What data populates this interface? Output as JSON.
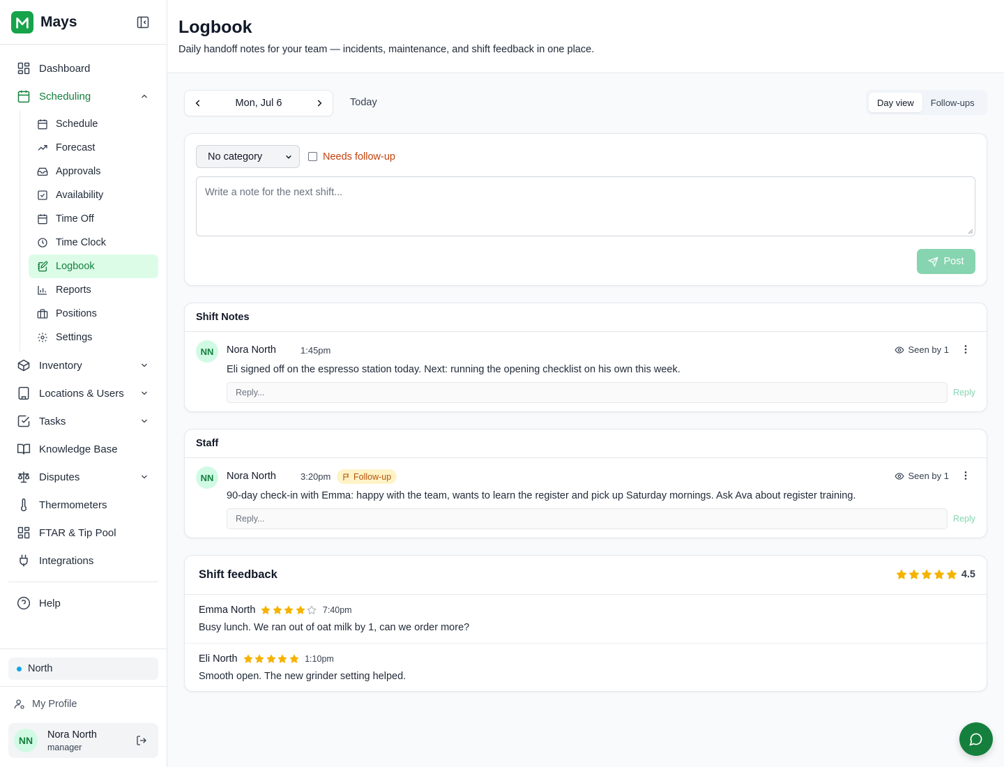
{
  "app": {
    "name": "Mays"
  },
  "colors": {
    "accent": "#15803d",
    "accent_light": "#dcfce7",
    "followup": "#c2410c",
    "star": "#f5b301",
    "location_dot": "#0ea5e9"
  },
  "sidebar": {
    "items": [
      {
        "label": "Dashboard",
        "icon": "dashboard-icon"
      },
      {
        "label": "Scheduling",
        "icon": "calendar-icon",
        "expanded": true
      },
      {
        "label": "Inventory",
        "icon": "box-icon",
        "expandable": true
      },
      {
        "label": "Locations & Users",
        "icon": "building-icon",
        "expandable": true
      },
      {
        "label": "Tasks",
        "icon": "checkbox-icon",
        "expandable": true
      },
      {
        "label": "Knowledge Base",
        "icon": "book-icon"
      },
      {
        "label": "Disputes",
        "icon": "scale-icon",
        "expandable": true
      },
      {
        "label": "Thermometers",
        "icon": "thermometer-icon"
      },
      {
        "label": "FTAR & Tip Pool",
        "icon": "grid-icon"
      },
      {
        "label": "Integrations",
        "icon": "plug-icon"
      },
      {
        "label": "Help",
        "icon": "help-icon"
      }
    ],
    "scheduling_sub": [
      {
        "label": "Schedule",
        "icon": "calendar-icon"
      },
      {
        "label": "Forecast",
        "icon": "trending-up-icon"
      },
      {
        "label": "Approvals",
        "icon": "inbox-icon"
      },
      {
        "label": "Availability",
        "icon": "calendar-check-icon"
      },
      {
        "label": "Time Off",
        "icon": "calendar-icon"
      },
      {
        "label": "Time Clock",
        "icon": "clock-icon"
      },
      {
        "label": "Logbook",
        "icon": "notebook-pen-icon",
        "active": true
      },
      {
        "label": "Reports",
        "icon": "bar-chart-icon"
      },
      {
        "label": "Positions",
        "icon": "briefcase-icon"
      },
      {
        "label": "Settings",
        "icon": "gear-icon"
      }
    ],
    "location": "North",
    "my_profile": "My Profile",
    "user": {
      "initials": "NN",
      "name": "Nora North",
      "role": "manager"
    }
  },
  "header": {
    "title": "Logbook",
    "subtitle": "Daily handoff notes for your team — incidents, maintenance, and shift feedback in one place."
  },
  "toolbar": {
    "date": "Mon, Jul 6",
    "today": "Today",
    "views": [
      "Day view",
      "Follow-ups"
    ],
    "active_view": "Day view"
  },
  "composer": {
    "category": "No category",
    "followup_label": "Needs follow-up",
    "followup_checked": false,
    "placeholder": "Write a note for the next shift...",
    "post_label": "Post"
  },
  "sections": [
    {
      "title": "Shift Notes",
      "notes": [
        {
          "initials": "NN",
          "author": "Nora North",
          "time": "1:45pm",
          "followup": "",
          "seen": "Seen by 1",
          "text": "Eli signed off on the espresso station today. Next: running the opening checklist on his own this week.",
          "reply_placeholder": "Reply...",
          "reply_label": "Reply"
        }
      ]
    },
    {
      "title": "Staff",
      "notes": [
        {
          "initials": "NN",
          "author": "Nora North",
          "time": "3:20pm",
          "followup": "Follow-up",
          "seen": "Seen by 1",
          "text": "90-day check-in with Emma: happy with the team, wants to learn the register and pick up Saturday mornings. Ask Ava about register training.",
          "reply_placeholder": "Reply...",
          "reply_label": "Reply"
        }
      ]
    }
  ],
  "feedback": {
    "title": "Shift feedback",
    "overall_rating": 4.5,
    "overall_label": "4.5",
    "entries": [
      {
        "name": "Emma North",
        "rating": 4,
        "time": "7:40pm",
        "text": "Busy lunch. We ran out of oat milk by 1, can we order more?"
      },
      {
        "name": "Eli North",
        "rating": 5,
        "time": "1:10pm",
        "text": "Smooth open. The new grinder setting helped."
      }
    ]
  }
}
